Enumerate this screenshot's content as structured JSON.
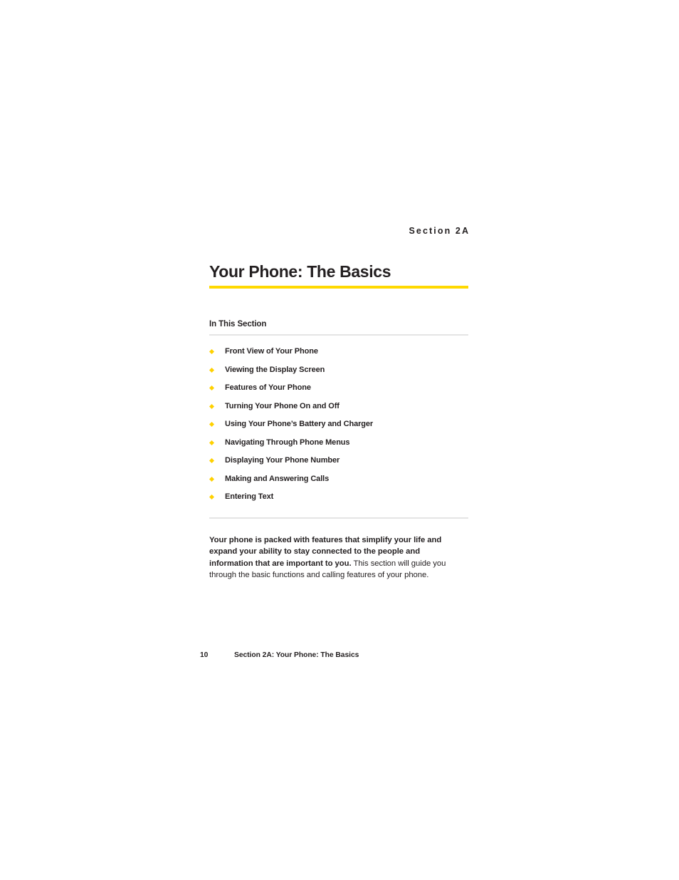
{
  "document": {
    "section_eyebrow": "Section 2A",
    "title": "Your Phone: The Basics",
    "in_this_section_heading": "In This Section",
    "toc_items": [
      {
        "label": "Front View of Your Phone"
      },
      {
        "label": "Viewing the Display Screen"
      },
      {
        "label": "Features of Your Phone"
      },
      {
        "label": "Turning Your Phone On and Off"
      },
      {
        "label": "Using Your Phone’s Battery and Charger"
      },
      {
        "label": "Navigating Through Phone Menus"
      },
      {
        "label": "Displaying Your Phone Number"
      },
      {
        "label": "Making and Answering Calls"
      },
      {
        "label": "Entering Text"
      }
    ],
    "intro": {
      "lead_bold": "Your phone is packed with features that simplify your life and expand your ability to stay connected to the people and information that are important to you.",
      "rest": " This section will guide you through the basic functions and calling features of your phone."
    },
    "footer": {
      "page_number": "10",
      "section_title": "Section 2A: Your Phone: The Basics"
    },
    "colors": {
      "accent_rule": "#ffd900",
      "bullet": "#ffd100",
      "hairline": "#e4e4e4",
      "text": "#231f20",
      "page_background": "#ffffff"
    },
    "icons": {
      "bullet": "diamond-bullet-icon"
    }
  }
}
